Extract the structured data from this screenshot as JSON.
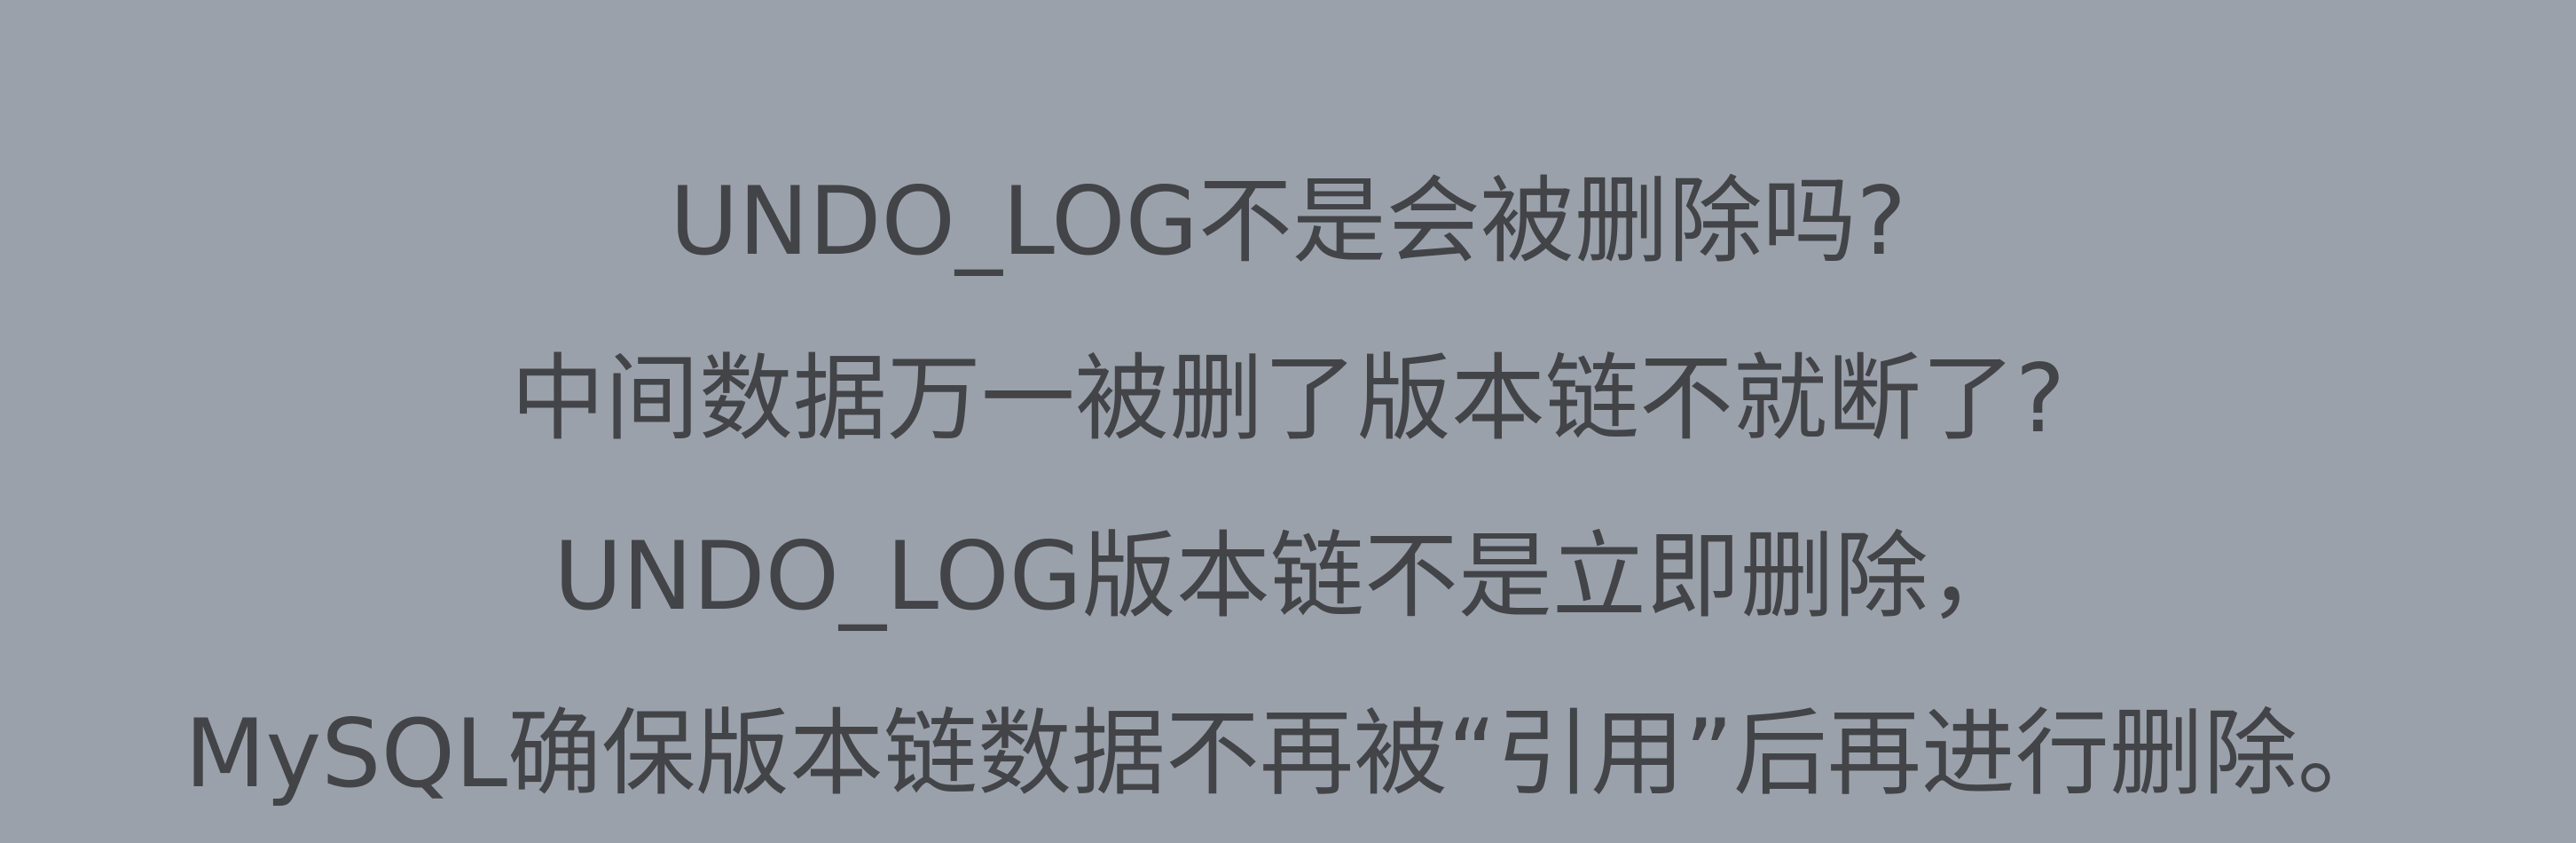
{
  "slide": {
    "background_color": "#9ba1ab",
    "text_color": "#424448",
    "lines": [
      "UNDO_LOG不是会被删除吗?",
      "中间数据万一被删了版本链不就断了?",
      "UNDO_LOG版本链不是立即删除，",
      "MySQL确保版本链数据不再被“引用”后再进行删除。"
    ]
  }
}
